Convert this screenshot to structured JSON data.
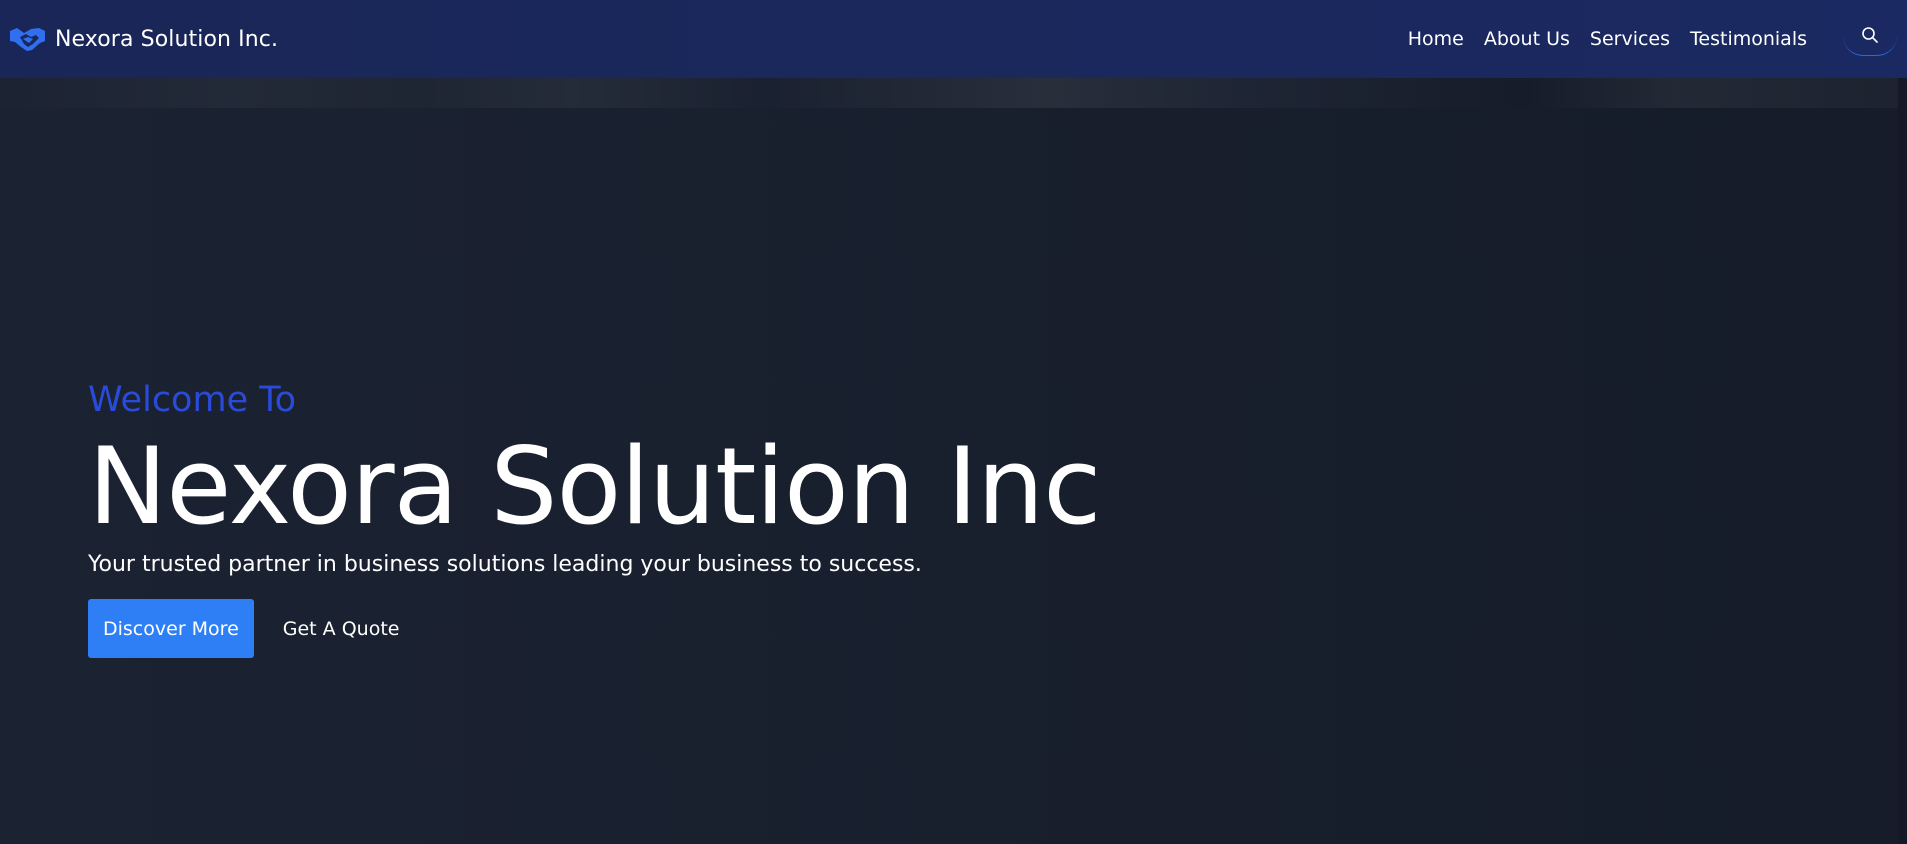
{
  "navbar": {
    "brand_name": "Nexora Solution Inc.",
    "brand_icon": "handshake-icon",
    "links": [
      "Home",
      "About Us",
      "Services",
      "Testimonials"
    ],
    "search_icon": "search-icon"
  },
  "hero": {
    "welcome": "Welcome To",
    "headline": "Nexora Solution Inc",
    "tagline": "Your trusted partner in business solutions leading your business to success.",
    "primary_button": "Discover More",
    "secondary_button": "Get A Quote"
  },
  "colors": {
    "navbar_bg": "#1b285c",
    "accent": "#2a4bd9",
    "button_bg": "#2e7ff6",
    "hero_bg": "#1b2130"
  }
}
